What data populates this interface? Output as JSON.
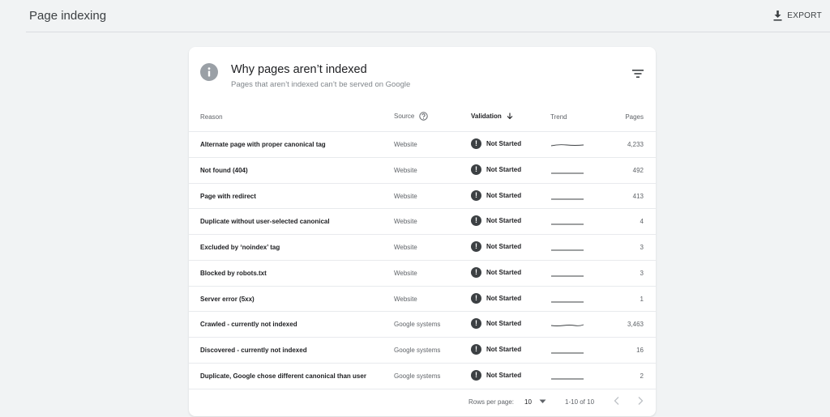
{
  "header": {
    "title": "Page indexing",
    "export_label": "EXPORT"
  },
  "card": {
    "title": "Why pages aren’t indexed",
    "subtitle": "Pages that aren’t indexed can’t be served on Google"
  },
  "table": {
    "columns": {
      "reason": "Reason",
      "source": "Source",
      "validation": "Validation",
      "trend": "Trend",
      "pages": "Pages"
    },
    "rows": [
      {
        "reason": "Alternate page with proper canonical tag",
        "source": "Website",
        "validation": "Not Started",
        "pages": "4,233"
      },
      {
        "reason": "Not found (404)",
        "source": "Website",
        "validation": "Not Started",
        "pages": "492"
      },
      {
        "reason": "Page with redirect",
        "source": "Website",
        "validation": "Not Started",
        "pages": "413"
      },
      {
        "reason": "Duplicate without user-selected canonical",
        "source": "Website",
        "validation": "Not Started",
        "pages": "4"
      },
      {
        "reason": "Excluded by ‘noindex’ tag",
        "source": "Website",
        "validation": "Not Started",
        "pages": "3"
      },
      {
        "reason": "Blocked by robots.txt",
        "source": "Website",
        "validation": "Not Started",
        "pages": "3"
      },
      {
        "reason": "Server error (5xx)",
        "source": "Website",
        "validation": "Not Started",
        "pages": "1"
      },
      {
        "reason": "Crawled - currently not indexed",
        "source": "Google systems",
        "validation": "Not Started",
        "pages": "3,463"
      },
      {
        "reason": "Discovered - currently not indexed",
        "source": "Google systems",
        "validation": "Not Started",
        "pages": "16"
      },
      {
        "reason": "Duplicate, Google chose different canonical than user",
        "source": "Google systems",
        "validation": "Not Started",
        "pages": "2"
      }
    ]
  },
  "pagination": {
    "rows_per_page_label": "Rows per page:",
    "rows_per_page_value": "10",
    "range": "1-10 of 10"
  },
  "icons": {
    "export": "download-icon",
    "info": "info-icon",
    "filter": "filter-icon",
    "help": "help-circle-icon",
    "sort": "arrow-down-icon",
    "status": "exclamation-icon",
    "prev": "chevron-left-icon",
    "next": "chevron-right-icon"
  },
  "colors": {
    "background": "#f1f3f4",
    "card": "#ffffff",
    "status_icon": "#3c4043",
    "info_icon": "#9aa0a6"
  }
}
